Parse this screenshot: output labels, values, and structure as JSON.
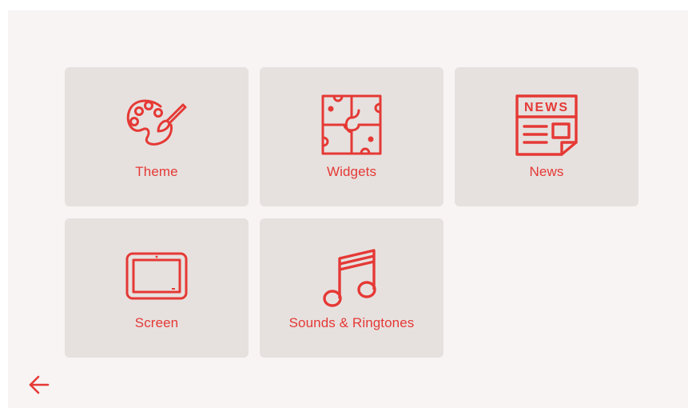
{
  "colors": {
    "accent": "#e53935",
    "tile_background": "#e6e1df",
    "page_background": "#f7f4f3"
  },
  "tiles": [
    {
      "label": "Theme",
      "icon": "palette-icon"
    },
    {
      "label": "Widgets",
      "icon": "puzzle-icon"
    },
    {
      "label": "News",
      "icon": "newspaper-icon"
    },
    {
      "label": "Screen",
      "icon": "tablet-screen-icon"
    },
    {
      "label": "Sounds & Ringtones",
      "icon": "music-note-icon"
    }
  ],
  "news_icon_text": "NEWS",
  "back": {
    "icon": "arrow-left-icon"
  }
}
